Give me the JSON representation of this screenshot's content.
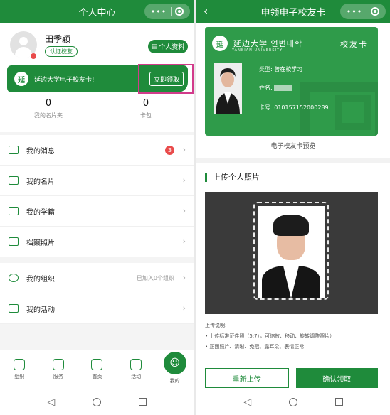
{
  "left": {
    "title": "个人中心",
    "profile": {
      "name": "田季颖",
      "tag": "认证校友",
      "button": "个人资料"
    },
    "banner": {
      "logo": "延",
      "text": "延边大学电子校友卡!",
      "button": "立即领取"
    },
    "stats": [
      {
        "value": "0",
        "label": "我的名片夹"
      },
      {
        "value": "0",
        "label": "卡包"
      }
    ],
    "menu_group1": [
      {
        "label": "我的消息",
        "badge": "3"
      },
      {
        "label": "我的名片"
      },
      {
        "label": "我的学籍"
      },
      {
        "label": "档案照片"
      }
    ],
    "menu_group2": [
      {
        "label": "我的组织",
        "right": "已加入0个组织"
      },
      {
        "label": "我的活动"
      }
    ],
    "tabs": [
      "组织",
      "服务",
      "首页",
      "活动",
      "我的"
    ]
  },
  "right": {
    "title": "申领电子校友卡",
    "card": {
      "logo": "延",
      "school": "延边大学 연변대학",
      "school_en": "YANBIAN UNIVERSITY",
      "type_title": "校友卡",
      "type_label": "类型:",
      "type_value": "曾在校学习",
      "name_label": "姓名:",
      "id_label": "卡号:",
      "id_value": "010157152000289"
    },
    "preview_label": "电子校友卡预览",
    "section_title": "上传个人照片",
    "notes": [
      "上传说明:",
      "• 上传标准证件照（5:7），可缩放、移动、旋转调整照片）",
      "• 正面照片、清晰、免冠、露耳朵、表情正常"
    ],
    "buttons": {
      "reupload": "重新上传",
      "confirm": "确认领取"
    }
  },
  "colors": {
    "brand": "#1f8b3b",
    "highlight": "#d23b8b",
    "badge": "#e94b4b"
  }
}
